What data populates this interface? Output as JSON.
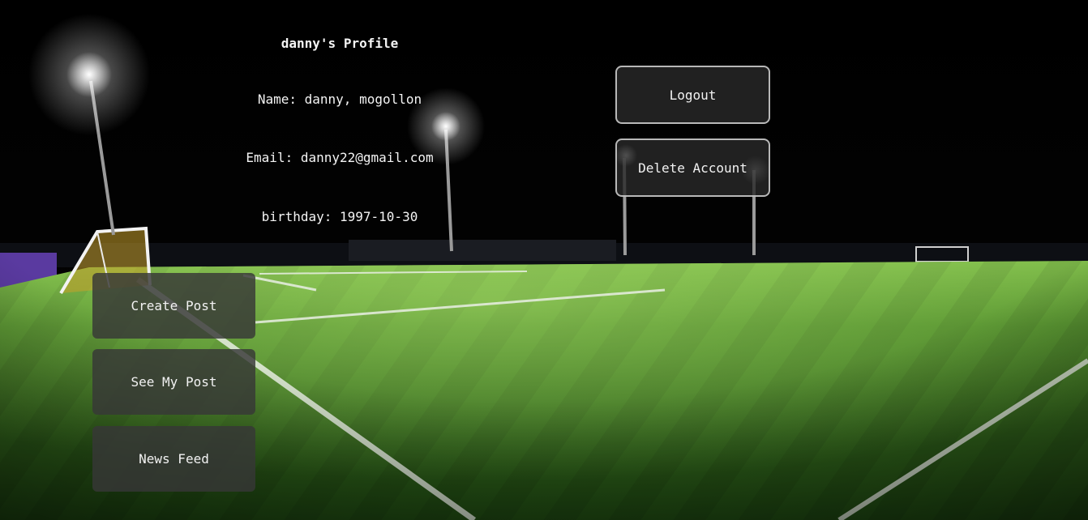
{
  "profile": {
    "title": "danny's Profile",
    "name_line": "Name: danny, mogollon",
    "email_line": "Email: danny22@gmail.com",
    "birthday_line": "birthday: 1997-10-30"
  },
  "account_actions": {
    "logout_label": "Logout",
    "delete_label": "Delete Account"
  },
  "nav": {
    "create_post_label": "Create Post",
    "see_my_post_label": "See My Post",
    "news_feed_label": "News Feed"
  },
  "colors": {
    "night_sky": "#000000",
    "pitch_green": "#3f7a22",
    "button_fill": "#2e2e2e",
    "text": "#f2f2f2"
  }
}
